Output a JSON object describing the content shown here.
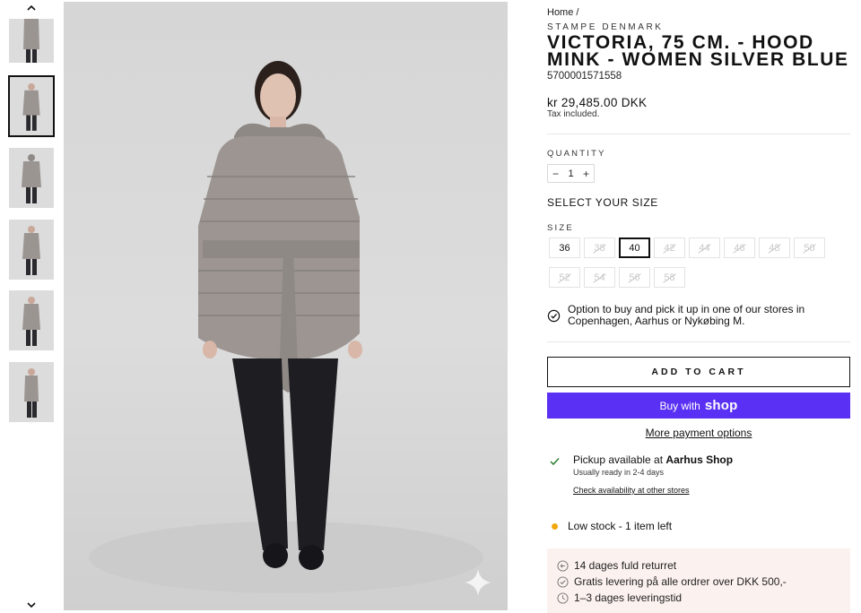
{
  "gallery": {
    "prev_arrow": "chevron-up-icon",
    "next_arrow": "chevron-down-icon",
    "thumbnails": 6,
    "active_index": 1
  },
  "product": {
    "breadcrumb": "Home /",
    "vendor": "STAMPE DENMARK",
    "title": "VICTORIA, 75 CM. - HOOD MINK - WOMEN SILVER BLUE",
    "sku": "5700001571558",
    "price": "kr 29,485.00 DKK",
    "tax_note": "Tax included."
  },
  "quantity": {
    "label": "QUANTITY",
    "value": "1",
    "minus": "−",
    "plus": "+"
  },
  "size": {
    "heading": "SELECT YOUR SIZE",
    "label": "SIZE",
    "options": [
      {
        "label": "36",
        "available": true
      },
      {
        "label": "38",
        "available": false
      },
      {
        "label": "40",
        "available": true,
        "selected": true
      },
      {
        "label": "42",
        "available": false
      },
      {
        "label": "44",
        "available": false
      },
      {
        "label": "46",
        "available": false
      },
      {
        "label": "48",
        "available": false
      },
      {
        "label": "50",
        "available": false
      },
      {
        "label": "52",
        "available": false
      },
      {
        "label": "54",
        "available": false
      },
      {
        "label": "56",
        "available": false
      },
      {
        "label": "58",
        "available": false
      }
    ]
  },
  "store_option": "Option to buy and pick it up in one of our stores in Copenhagen, Aarhus or Nykøbing M.",
  "buttons": {
    "add_to_cart": "ADD TO CART",
    "buy_with": "Buy with",
    "shop_logo": "shop",
    "more_payment": "More payment options"
  },
  "pickup": {
    "prefix": "Pickup available at",
    "store": "Aarhus Shop",
    "ready": "Usually ready in 2-4 days",
    "check_link": "Check availability at other stores"
  },
  "stock": "Low stock - 1 item left",
  "perks": [
    {
      "icon": "return-icon",
      "text": "14 dages fuld returret"
    },
    {
      "icon": "check-circle-icon",
      "text": "Gratis levering på alle ordrer over DKK 500,-"
    },
    {
      "icon": "clock-icon",
      "text": "1–3 dages leveringstid"
    }
  ],
  "colors": {
    "shop_pay": "#5a31f4",
    "stock_dot": "#f0a80e",
    "perks_bg": "#fbf1ee",
    "pickup_check": "#2e7d32"
  }
}
